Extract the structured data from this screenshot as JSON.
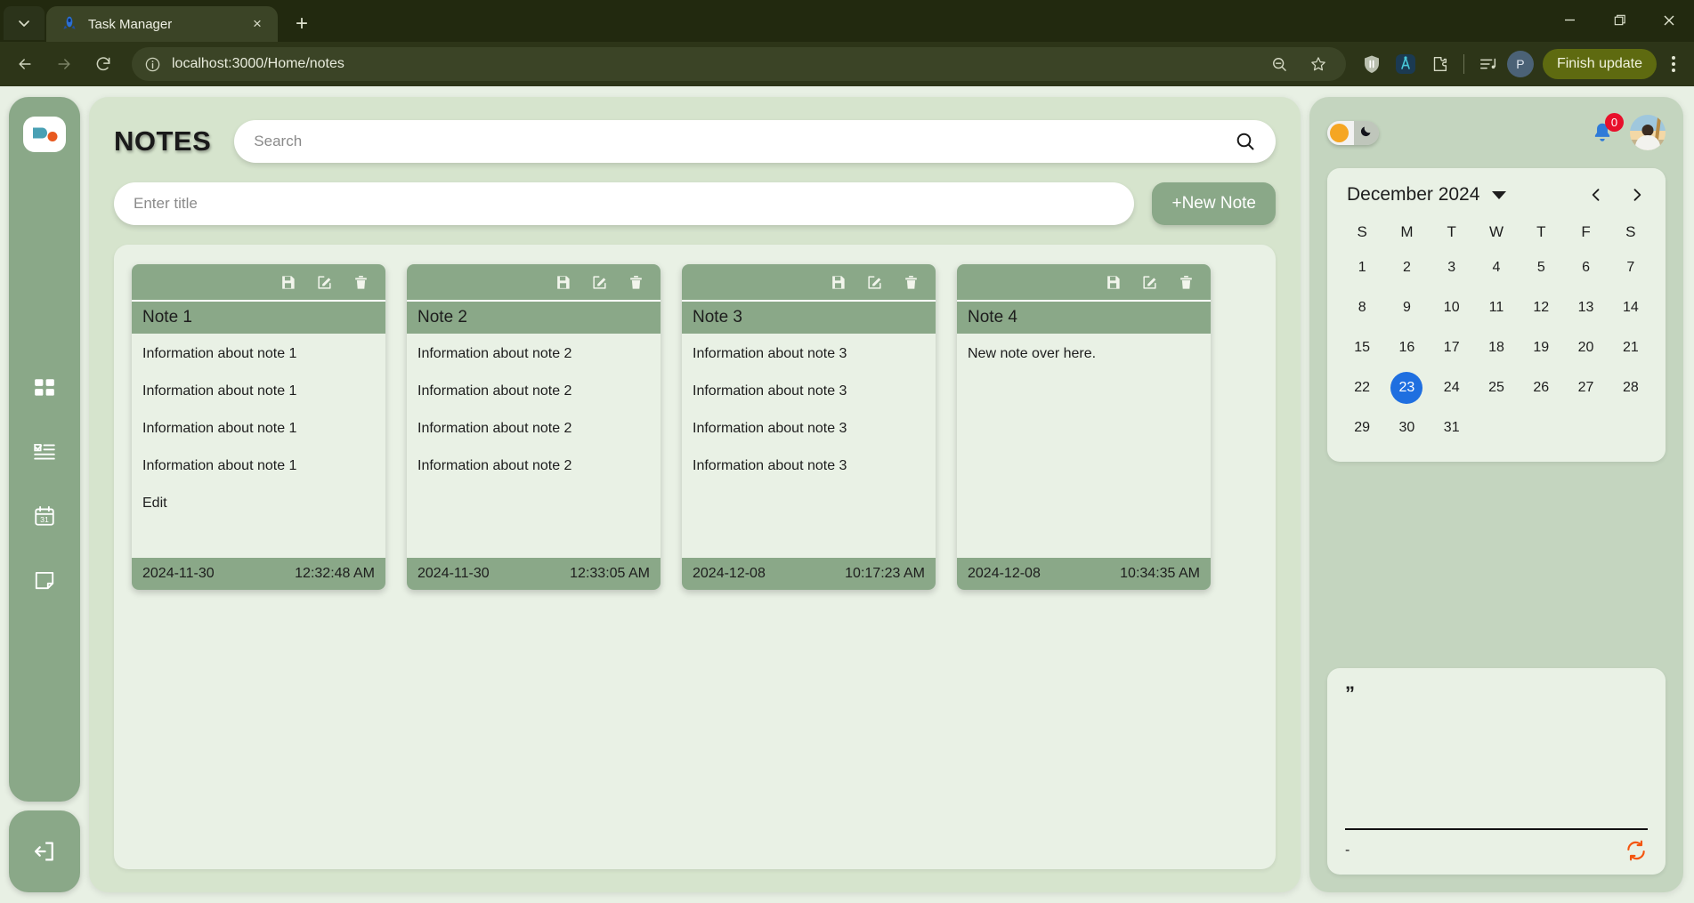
{
  "browser": {
    "tab": {
      "title": "Task Manager",
      "favicon": "rocket-icon",
      "close": "×"
    },
    "new_tab_label": "+",
    "nav": {
      "back": "←",
      "forward": "→",
      "reload": "⟳"
    },
    "url": "localhost:3000/Home/notes",
    "toolbar_icons": [
      "zoom-out-icon",
      "bookmark-star-icon",
      "shield-icon",
      "extension-ai-icon",
      "extensions-puzzle-icon",
      "media-playlist-icon"
    ],
    "profile_initial": "P",
    "update_button": "Finish update",
    "window": {
      "minimize": "–",
      "maximize": "❐",
      "close": "✕"
    }
  },
  "sidebar": {
    "logo": "app-logo",
    "items": [
      {
        "name": "dashboard",
        "icon": "grid-dashboard-icon"
      },
      {
        "name": "tasks",
        "icon": "checklist-icon"
      },
      {
        "name": "calendar",
        "icon": "calendar-31-icon",
        "label": "31"
      },
      {
        "name": "notes",
        "icon": "note-icon"
      }
    ],
    "logout": {
      "name": "logout",
      "icon": "logout-icon"
    }
  },
  "main": {
    "title": "NOTES",
    "search": {
      "placeholder": "Search",
      "value": "",
      "icon": "search-icon"
    },
    "title_input": {
      "placeholder": "Enter title",
      "value": ""
    },
    "new_note_button": "+New Note",
    "card_actions": [
      {
        "name": "save",
        "icon": "save-floppy-icon"
      },
      {
        "name": "edit",
        "icon": "edit-pencil-icon"
      },
      {
        "name": "delete",
        "icon": "trash-icon"
      }
    ],
    "notes": [
      {
        "title": "Note 1",
        "lines": [
          "Information about note 1",
          "Information about note 1",
          "Information about note 1",
          "Information about note 1",
          "Edit"
        ],
        "date": "2024-11-30",
        "time": "12:32:48 AM"
      },
      {
        "title": "Note 2",
        "lines": [
          "Information about note 2",
          "Information about note 2",
          "Information about note 2",
          "Information about note 2"
        ],
        "date": "2024-11-30",
        "time": "12:33:05 AM"
      },
      {
        "title": "Note 3",
        "lines": [
          "Information about note 3",
          "Information about note 3",
          "Information about note 3",
          "Information about note 3"
        ],
        "date": "2024-12-08",
        "time": "10:17:23 AM"
      },
      {
        "title": "Note 4",
        "lines": [
          "New note over here."
        ],
        "date": "2024-12-08",
        "time": "10:34:35 AM"
      }
    ]
  },
  "right": {
    "theme_toggle": {
      "light_icon": "sun-icon",
      "dark_icon": "moon-icon",
      "state": "light"
    },
    "notifications": {
      "icon": "bell-icon",
      "count": "0"
    },
    "avatar": "user-avatar",
    "calendar": {
      "month_label": "December 2024",
      "prev": "‹",
      "next": "›",
      "dow": [
        "S",
        "M",
        "T",
        "W",
        "T",
        "F",
        "S"
      ],
      "lead_blanks": 0,
      "days": [
        1,
        2,
        3,
        4,
        5,
        6,
        7,
        8,
        9,
        10,
        11,
        12,
        13,
        14,
        15,
        16,
        17,
        18,
        19,
        20,
        21,
        22,
        23,
        24,
        25,
        26,
        27,
        28,
        29,
        30,
        31
      ],
      "selected_day": 23,
      "selected_color": "#1f6fe0"
    },
    "quote": {
      "open_mark": "”",
      "text": "",
      "author": "-",
      "refresh_icon": "refresh-icon",
      "refresh_color": "#f4550e"
    }
  },
  "colors": {
    "chrome": "#2d3518",
    "app_bg": "#e8f0e4",
    "sidebar": "#8aa888",
    "center": "#d6e4cd",
    "panel": "#e9f1e5",
    "right": "#c4d5bf",
    "accent": "#8aa888"
  }
}
